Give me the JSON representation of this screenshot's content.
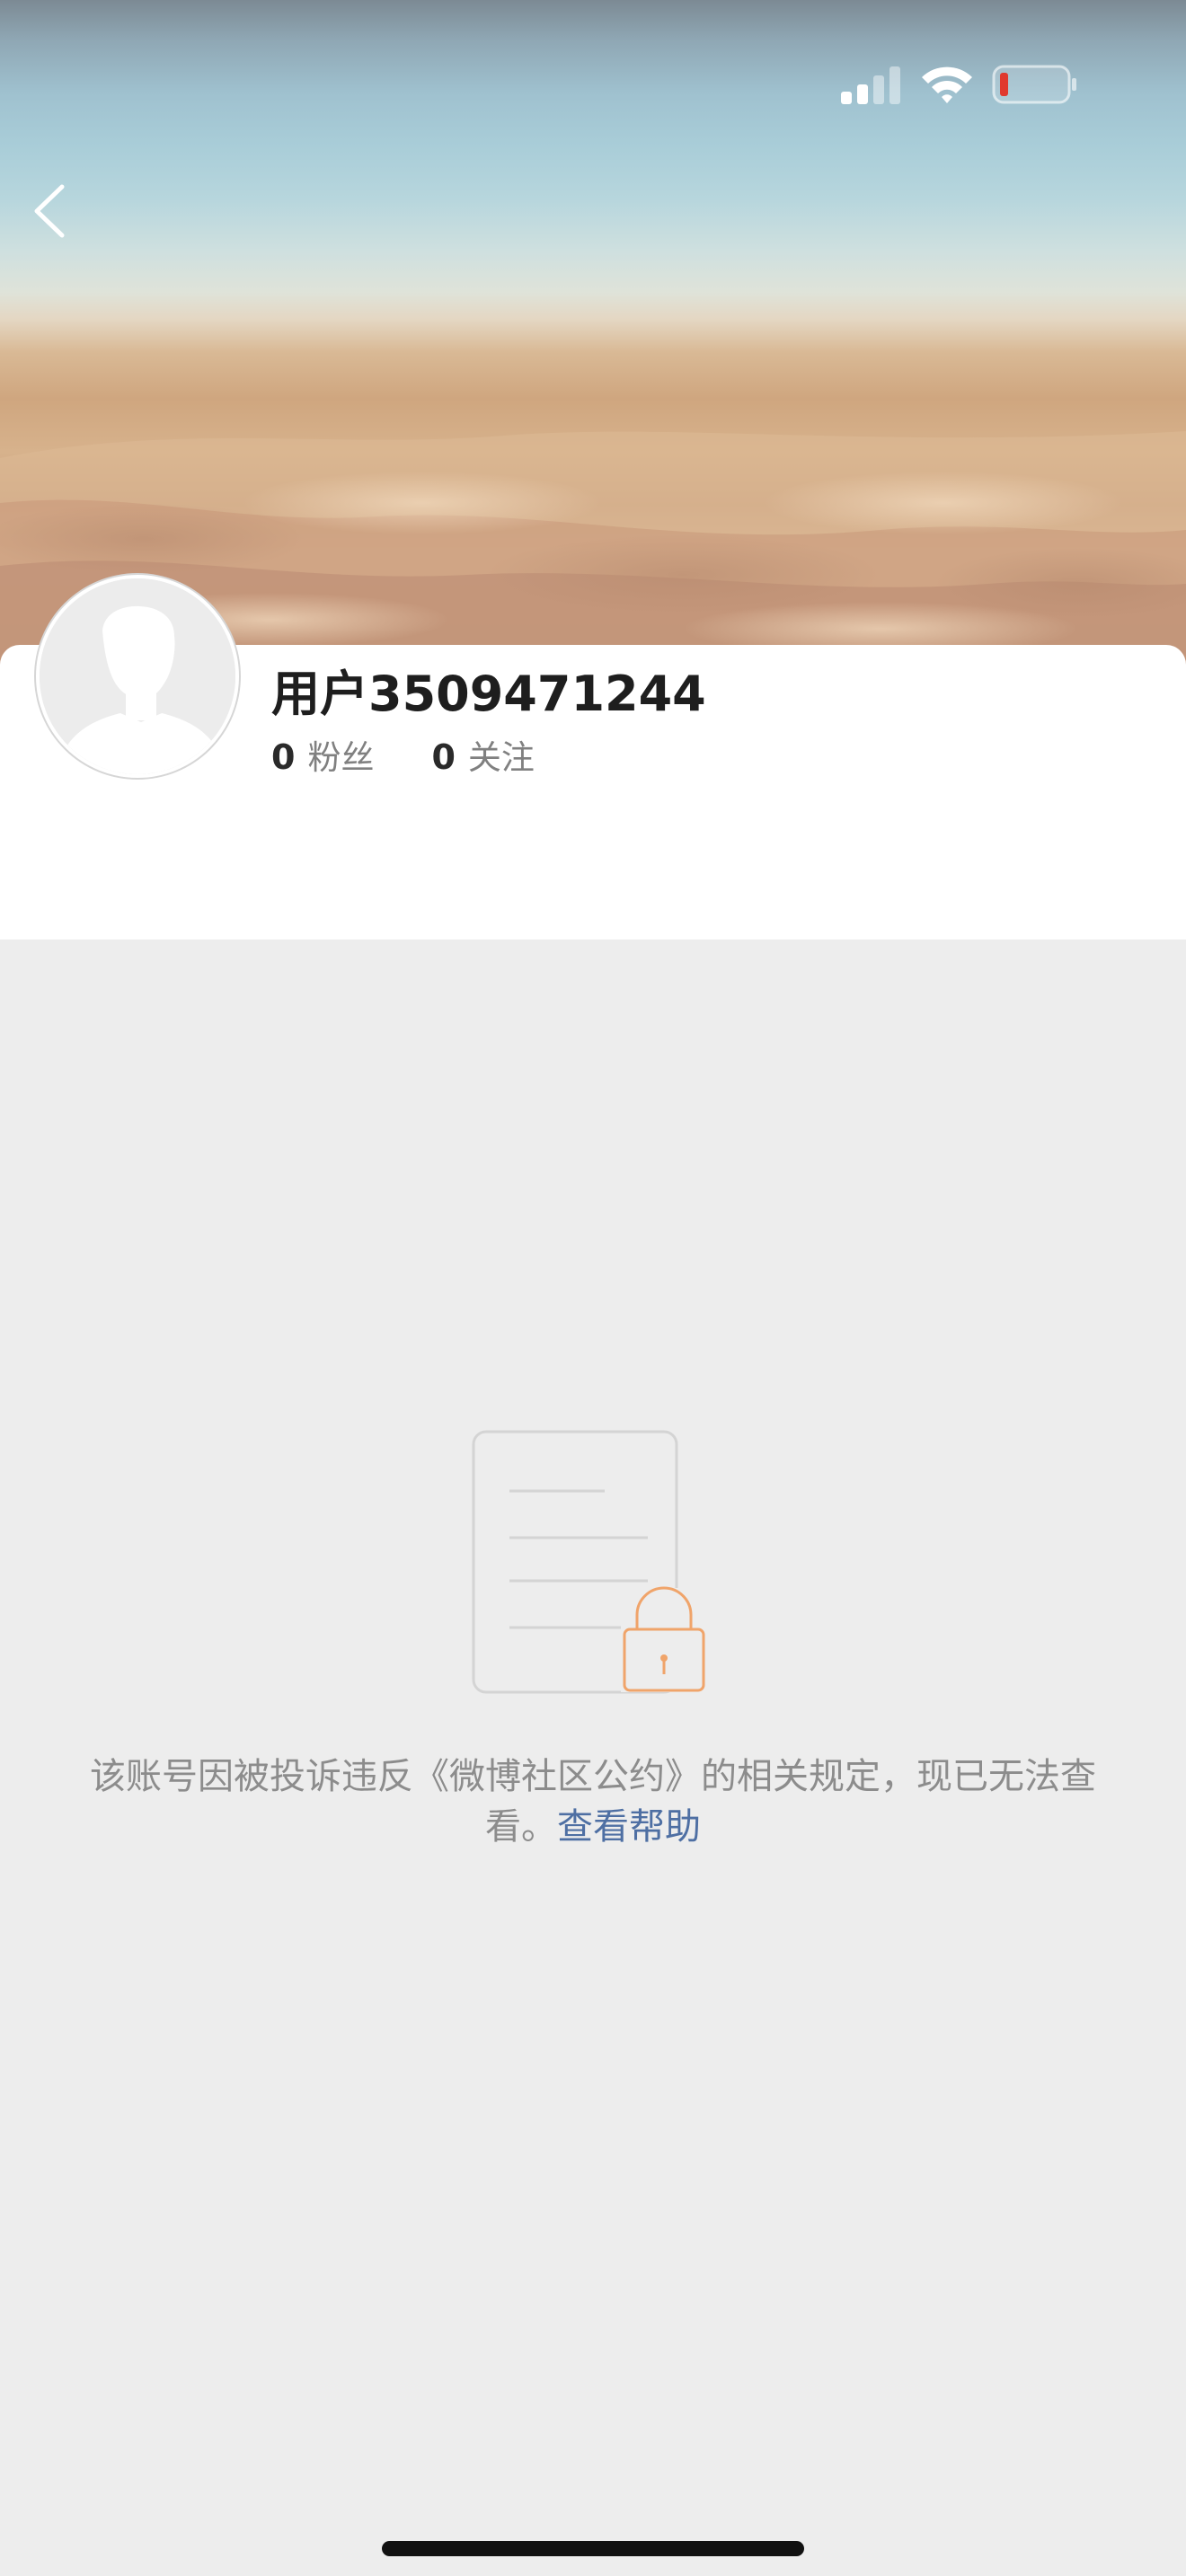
{
  "profile": {
    "username": "用户3509471244",
    "stats": [
      {
        "count": "0",
        "label": "粉丝"
      },
      {
        "count": "0",
        "label": "关注"
      }
    ]
  },
  "notice": {
    "message": "该账号因被投诉违反《微博社区公约》的相关规定，现已无法查看。",
    "link_label": "查看帮助"
  },
  "icons": {
    "back": "chevron-left-icon",
    "signal": "cellular-signal-icon",
    "wifi": "wifi-icon",
    "battery": "battery-icon",
    "avatar": "default-avatar-icon",
    "notice": "locked-document-icon"
  },
  "colors": {
    "link": "#4e6fa3",
    "battery_low": "#e0392f",
    "lock_accent": "#f0a46a",
    "page_background": "#ededed"
  }
}
